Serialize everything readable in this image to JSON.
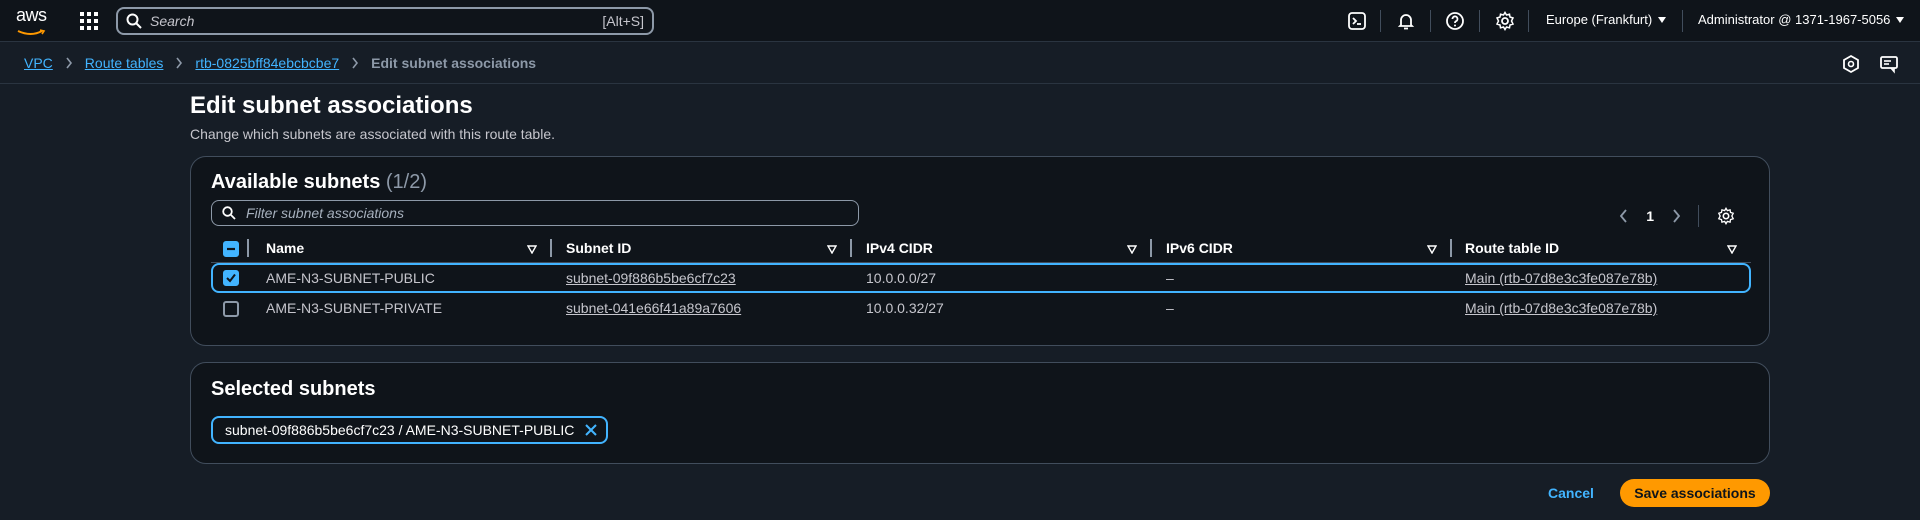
{
  "topnav": {
    "logo_text": "aws",
    "search_placeholder": "Search",
    "search_shortcut": "[Alt+S]",
    "region": "Europe (Frankfurt)",
    "account": "Administrator @ 1371-1967-5056"
  },
  "breadcrumb": {
    "items": [
      "VPC",
      "Route tables",
      "rtb-0825bff84ebcbcbe7"
    ],
    "current": "Edit subnet associations"
  },
  "page": {
    "title": "Edit subnet associations",
    "description": "Change which subnets are associated with this route table."
  },
  "available": {
    "title": "Available subnets",
    "count": "(1/2)",
    "filter_placeholder": "Filter subnet associations",
    "page_number": "1",
    "columns": [
      "Name",
      "Subnet ID",
      "IPv4 CIDR",
      "IPv6 CIDR",
      "Route table ID"
    ],
    "rows": [
      {
        "name": "AME-N3-SUBNET-PUBLIC",
        "subnet_id": "subnet-09f886b5be6cf7c23",
        "ipv4": "10.0.0.0/27",
        "ipv6": "–",
        "route_table": "Main (rtb-07d8e3c3fe087e78b)",
        "checked": true
      },
      {
        "name": "AME-N3-SUBNET-PRIVATE",
        "subnet_id": "subnet-041e66f41a89a7606",
        "ipv4": "10.0.0.32/27",
        "ipv6": "–",
        "route_table": "Main (rtb-07d8e3c3fe087e78b)",
        "checked": false
      }
    ]
  },
  "selected": {
    "title": "Selected subnets",
    "tokens": [
      "subnet-09f886b5be6cf7c23 / AME-N3-SUBNET-PUBLIC"
    ]
  },
  "actions": {
    "cancel": "Cancel",
    "save": "Save associations"
  },
  "colors": {
    "accent": "#42b4ff",
    "primary_button": "#ff9900",
    "background": "#161d26",
    "container": "#0f141a"
  }
}
